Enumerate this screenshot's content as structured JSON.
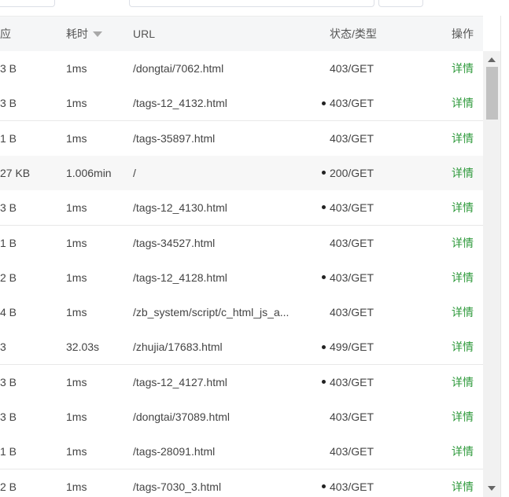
{
  "header": {
    "response_partial": "应",
    "time": "耗时",
    "url": "URL",
    "status": "状态/类型",
    "action": "操作"
  },
  "rows": [
    {
      "size": "3 B",
      "time": "1ms",
      "url": "/dongtai/7062.html",
      "dot": false,
      "status": "403/GET",
      "action": "详情"
    },
    {
      "size": "3 B",
      "time": "1ms",
      "url": "/tags-12_4132.html",
      "dot": true,
      "status": "403/GET",
      "action": "详情"
    },
    {
      "size": "1 B",
      "time": "1ms",
      "url": "/tags-35897.html",
      "dot": false,
      "status": "403/GET",
      "action": "详情"
    },
    {
      "size": "27 KB",
      "time": "1.006min",
      "url": "/",
      "dot": true,
      "status": "200/GET",
      "action": "详情",
      "highlight": true
    },
    {
      "size": "3 B",
      "time": "1ms",
      "url": "/tags-12_4130.html",
      "dot": true,
      "status": "403/GET",
      "action": "详情"
    },
    {
      "size": "1 B",
      "time": "1ms",
      "url": "/tags-34527.html",
      "dot": false,
      "status": "403/GET",
      "action": "详情"
    },
    {
      "size": "2 B",
      "time": "1ms",
      "url": "/tags-12_4128.html",
      "dot": true,
      "status": "403/GET",
      "action": "详情"
    },
    {
      "size": "4 B",
      "time": "1ms",
      "url": "/zb_system/script/c_html_js_a...",
      "dot": false,
      "status": "403/GET",
      "action": "详情"
    },
    {
      "size": "3",
      "time": "32.03s",
      "url": "/zhujia/17683.html",
      "dot": true,
      "status": "499/GET",
      "action": "详情"
    },
    {
      "size": "3 B",
      "time": "1ms",
      "url": "/tags-12_4127.html",
      "dot": true,
      "status": "403/GET",
      "action": "详情"
    },
    {
      "size": "3 B",
      "time": "1ms",
      "url": "/dongtai/37089.html",
      "dot": false,
      "status": "403/GET",
      "action": "详情"
    },
    {
      "size": "1 B",
      "time": "1ms",
      "url": "/tags-28091.html",
      "dot": false,
      "status": "403/GET",
      "action": "详情"
    },
    {
      "size": "2 B",
      "time": "1ms",
      "url": "/tags-7030_3.html",
      "dot": true,
      "status": "403/GET",
      "action": "详情"
    }
  ],
  "colors": {
    "action_link": "#2f9a3c",
    "header_bg": "#f5f6f7",
    "highlight_row": "#f7f7f7"
  }
}
